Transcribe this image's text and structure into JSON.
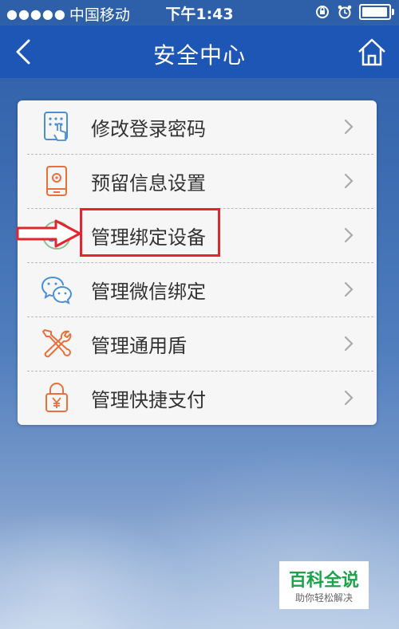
{
  "status": {
    "signal_dots": "●●●●●",
    "carrier": "中国移动",
    "time": "下午1:43",
    "battery_level": 0.85
  },
  "nav": {
    "title": "安全中心",
    "back_icon": "chevron-left-icon",
    "home_icon": "home-icon"
  },
  "menu": {
    "items": [
      {
        "label": "修改登录密码",
        "icon": "keypad-icon"
      },
      {
        "label": "预留信息设置",
        "icon": "phone-settings-icon"
      },
      {
        "label": "管理绑定设备",
        "icon": "link-icon"
      },
      {
        "label": "管理微信绑定",
        "icon": "wechat-icon"
      },
      {
        "label": "管理通用盾",
        "icon": "tools-icon"
      },
      {
        "label": "管理快捷支付",
        "icon": "lock-yuan-icon"
      }
    ]
  },
  "annotation": {
    "highlight_color": "#e3262e"
  },
  "watermark": {
    "title": "百科全说",
    "subtitle": "助你轻松解决"
  },
  "colors": {
    "nav_bg": "#1e56b5",
    "icon_blue": "#4a8fd6",
    "icon_orange": "#e8703a"
  }
}
